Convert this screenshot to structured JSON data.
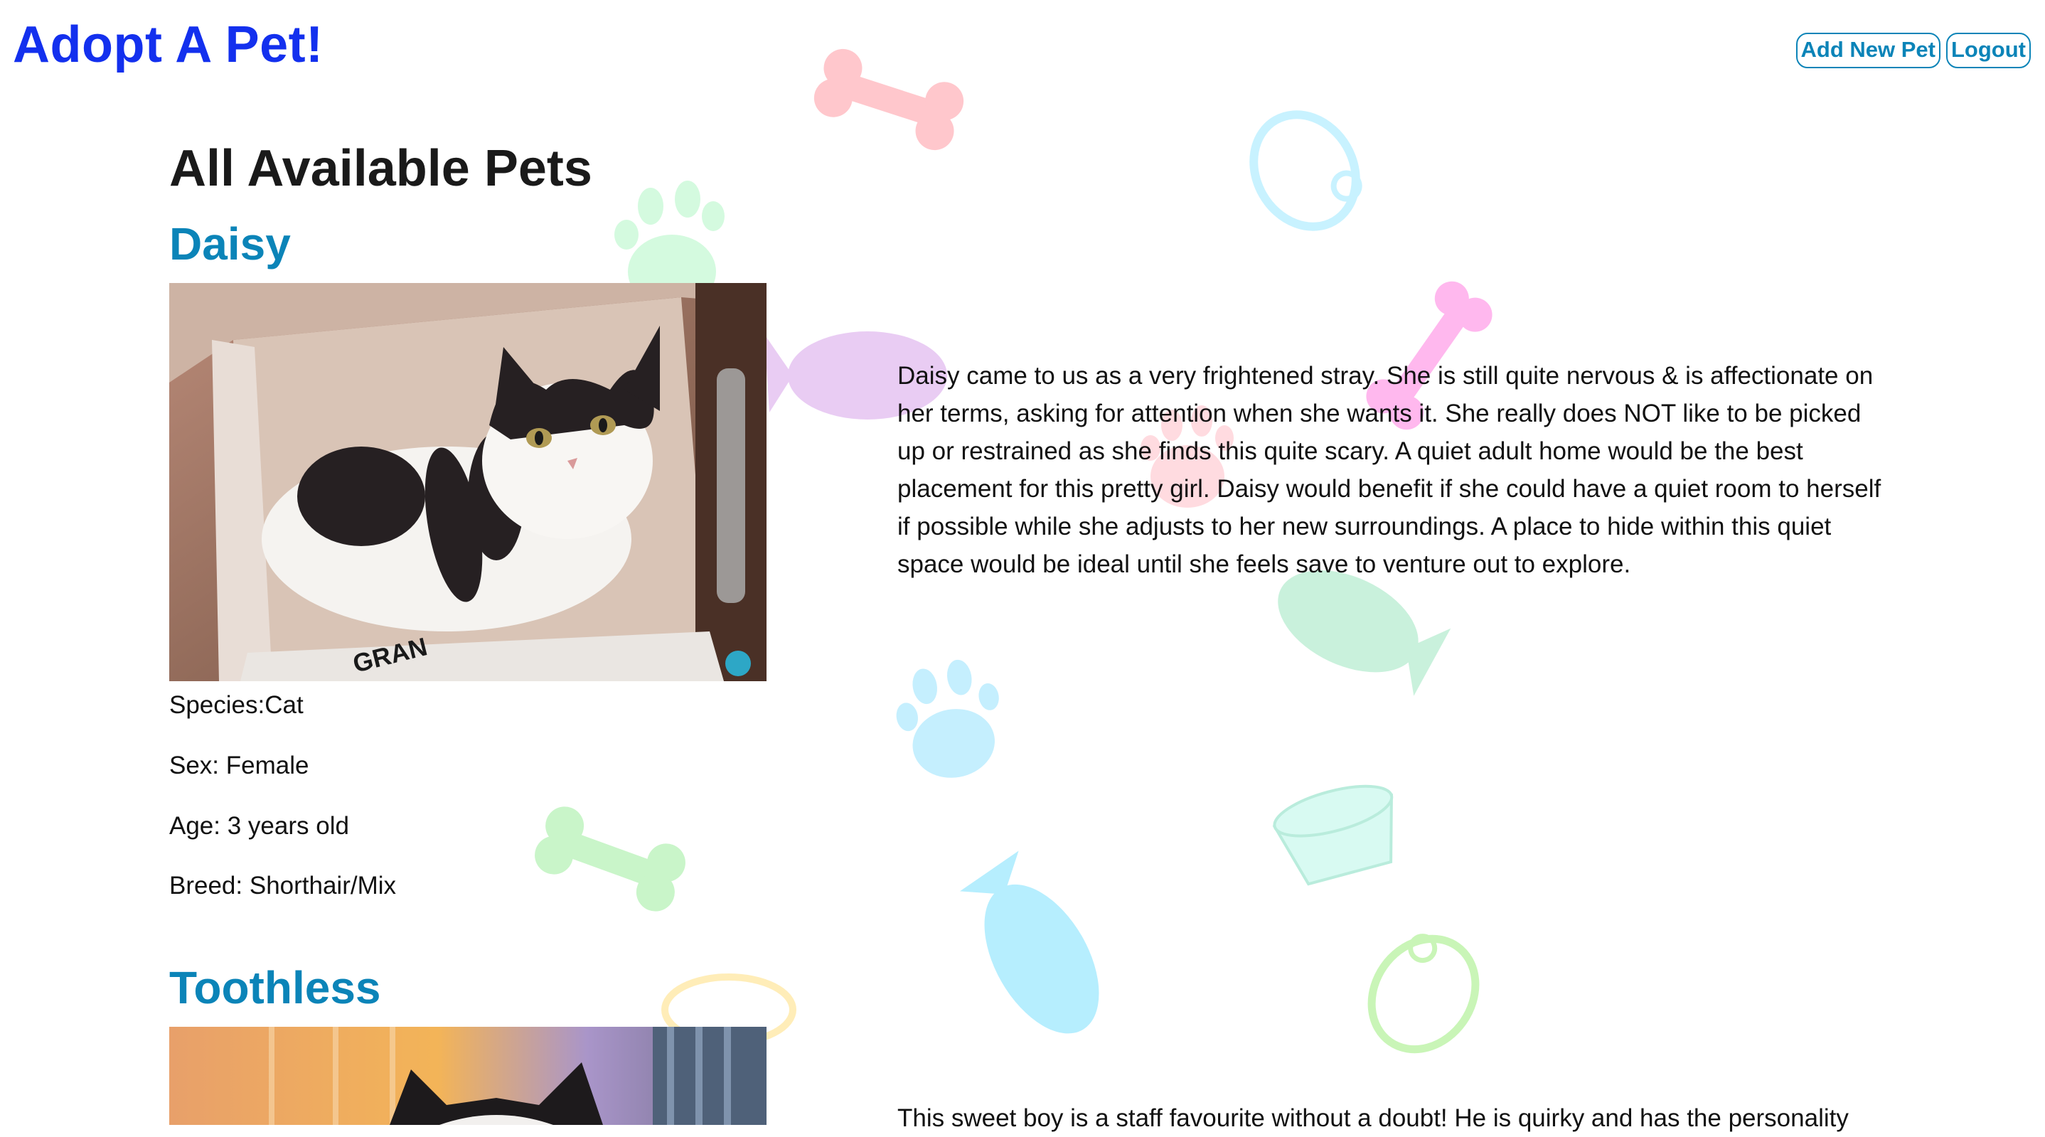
{
  "site": {
    "title": "Adopt A Pet!"
  },
  "nav": {
    "add_label": "Add New Pet",
    "logout_label": "Logout"
  },
  "main": {
    "heading": "All Available Pets"
  },
  "pets": [
    {
      "name": "Daisy",
      "species": "Species:Cat",
      "sex": "Sex: Female",
      "age": "Age: 3 years old",
      "breed": "Breed: Shorthair/Mix",
      "description": "Daisy came to us as a very frightened stray. She is still quite nervous & is affectionate on her terms, asking for attention when she wants it. She really does NOT like to be picked up or restrained as she finds this quite scary. A quiet adult home would be the best placement for this pretty girl. Daisy would benefit if she could have a quiet room to herself if possible while she adjusts to her new surroundings. A place to hide within this quiet space would be ideal until she feels save to venture out to explore.",
      "photo_text": "GRAN"
    },
    {
      "name": "Toothless",
      "description": "This sweet boy is a staff favourite without a doubt! He is quirky and has the personality"
    }
  ],
  "colors": {
    "title": "#1330ee",
    "accent": "#0b84b8",
    "text": "#1a1a1a"
  }
}
